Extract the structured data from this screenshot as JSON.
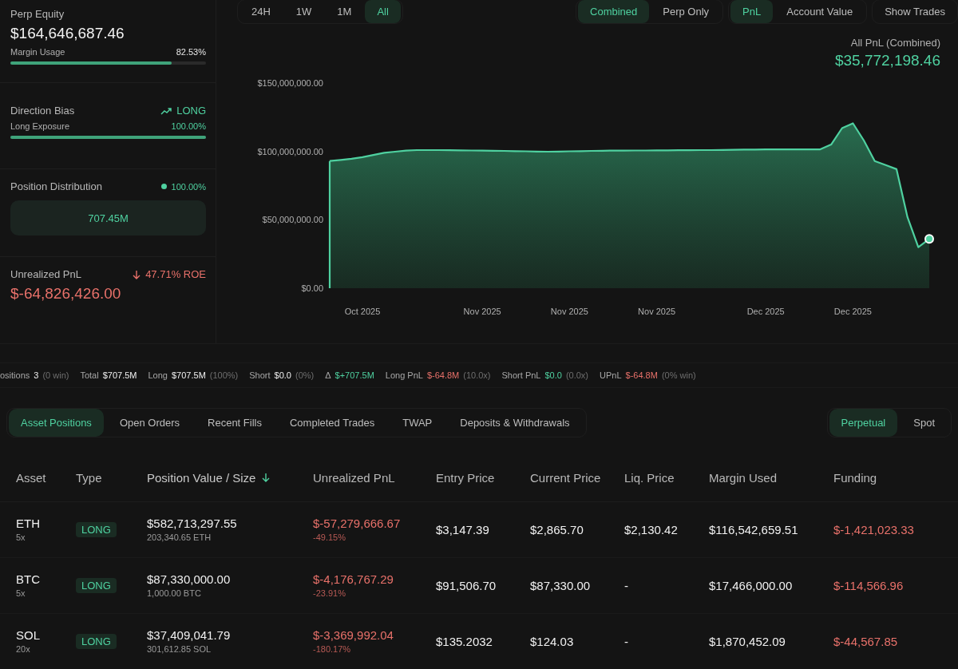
{
  "summary": {
    "perp_equity": {
      "label": "Perp Equity",
      "value": "$164,646,687.46"
    },
    "margin_usage": {
      "label": "Margin Usage",
      "reading": "82.53%",
      "level": 0.8253
    },
    "direction_bias": {
      "label": "Direction Bias",
      "value": "LONG",
      "exposure_label": "Long Exposure",
      "reading": "100.00%",
      "level": 1.0
    },
    "position_distribution": {
      "label": "Position Distribution",
      "reading": "100.00%",
      "color": "#4fd1a0",
      "segment": "707.45M"
    },
    "unrealized_pnl": {
      "label": "Unrealized PnL",
      "roe": "47.71% ROE",
      "value": "$-64,826,426.00"
    }
  },
  "chart_toolbar": {
    "ranges": [
      {
        "label": "24H",
        "selected": false
      },
      {
        "label": "1W",
        "selected": false
      },
      {
        "label": "1M",
        "selected": false
      },
      {
        "label": "All",
        "selected": true
      }
    ],
    "modes": [
      {
        "label": "Combined",
        "selected": true
      },
      {
        "label": "Perp Only",
        "selected": false
      }
    ],
    "metrics": [
      {
        "label": "PnL",
        "selected": true
      },
      {
        "label": "Account Value",
        "selected": false
      }
    ],
    "show_trades": "Show Trades"
  },
  "pnl_header": {
    "label": "All PnL (Combined)",
    "value": "$35,772,198.46"
  },
  "chart": {
    "chart_data": {
      "type": "area",
      "categories": [
        null,
        null,
        null,
        "Oct 2025",
        null,
        null,
        null,
        null,
        null,
        null,
        null,
        null,
        null,
        null,
        "Nov 2025",
        null,
        null,
        null,
        null,
        null,
        null,
        null,
        "Nov 2025",
        null,
        null,
        null,
        null,
        null,
        null,
        null,
        "Nov 2025",
        null,
        null,
        null,
        null,
        null,
        null,
        null,
        null,
        null,
        "Dec 2025",
        null,
        null,
        null,
        null,
        null,
        null,
        null,
        "Dec 2025",
        null,
        null,
        null,
        null,
        null,
        null,
        null
      ],
      "series": [
        {
          "color": "#4fd1a0",
          "values": [
            93000000,
            93800000,
            94600000,
            95800000,
            97400000,
            99000000,
            99800000,
            100600000,
            101000000,
            101000000,
            101000000,
            100900000,
            100800000,
            100700000,
            100600000,
            100500000,
            100400000,
            100200000,
            100100000,
            99900000,
            99800000,
            99900000,
            100100000,
            100200000,
            100400000,
            100500000,
            100600000,
            100600000,
            100700000,
            100700000,
            100800000,
            100800000,
            100900000,
            100900000,
            101000000,
            101000000,
            101100000,
            101200000,
            101300000,
            101400000,
            101500000,
            101500000,
            101500000,
            101500000,
            101500000,
            101500000,
            105000000,
            117000000,
            120500000,
            108000000,
            93000000,
            90000000,
            87000000,
            52000000,
            30000000,
            36000000
          ]
        }
      ],
      "ylim": [
        0,
        150000000
      ],
      "yticks": [
        {
          "value": 0,
          "label": "$0.00"
        },
        {
          "value": 50000000,
          "label": "$50,000,000.00"
        },
        {
          "value": 100000000,
          "label": "$100,000,000.00"
        },
        {
          "value": 150000000,
          "label": "$150,000,000.00"
        }
      ]
    }
  },
  "stats_strip": [
    {
      "label": "ositions",
      "value": "3",
      "note": "(0 win)",
      "color": "#f0f0f0"
    },
    {
      "label": "Total",
      "value": "$707.5M",
      "color": "#f0f0f0"
    },
    {
      "label": "Long",
      "value": "$707.5M",
      "note": "(100%)",
      "color": "#f0f0f0"
    },
    {
      "label": "Short",
      "value": "$0.0",
      "note": "(0%)",
      "color": "#f0f0f0"
    },
    {
      "label": "Δ",
      "value": "$+707.5M",
      "color": "#4fd1a0"
    },
    {
      "label": "Long PnL",
      "value": "$-64.8M",
      "note": "(10.0x)",
      "color": "#e8716a"
    },
    {
      "label": "Short PnL",
      "value": "$0.0",
      "note": "(0.0x)",
      "color": "#4fd1a0"
    },
    {
      "label": "UPnL",
      "value": "$-64.8M",
      "note": "(0% win)",
      "color": "#e8716a"
    }
  ],
  "tabs": [
    {
      "label": "Asset Positions",
      "selected": true
    },
    {
      "label": "Open Orders",
      "selected": false
    },
    {
      "label": "Recent Fills",
      "selected": false
    },
    {
      "label": "Completed Trades",
      "selected": false
    },
    {
      "label": "TWAP",
      "selected": false
    },
    {
      "label": "Deposits & Withdrawals",
      "selected": false
    }
  ],
  "market_tabs": [
    {
      "label": "Perpetual",
      "selected": true
    },
    {
      "label": "Spot",
      "selected": false
    }
  ],
  "table": {
    "columns": [
      {
        "label": "Asset",
        "sorted": false
      },
      {
        "label": "Type",
        "sorted": false
      },
      {
        "label": "Position Value / Size",
        "sorted": true
      },
      {
        "label": "Unrealized PnL",
        "sorted": false
      },
      {
        "label": "Entry Price",
        "sorted": false
      },
      {
        "label": "Current Price",
        "sorted": false
      },
      {
        "label": "Liq. Price",
        "sorted": false
      },
      {
        "label": "Margin Used",
        "sorted": false
      },
      {
        "label": "Funding",
        "sorted": false
      }
    ],
    "rows": [
      {
        "asset": "ETH",
        "leverage": "5x",
        "type": "LONG",
        "position_value": "$582,713,297.55",
        "size": "203,340.65 ETH",
        "unrealized_pnl": "$-57,279,666.67",
        "pnl_percent": "-49.15%",
        "entry_price": "$3,147.39",
        "current_price": "$2,865.70",
        "liq_price": "$2,130.42",
        "margin_used": "$116,542,659.51",
        "funding": "$-1,421,023.33"
      },
      {
        "asset": "BTC",
        "leverage": "5x",
        "type": "LONG",
        "position_value": "$87,330,000.00",
        "size": "1,000.00 BTC",
        "unrealized_pnl": "$-4,176,767.29",
        "pnl_percent": "-23.91%",
        "entry_price": "$91,506.70",
        "current_price": "$87,330.00",
        "liq_price": "-",
        "margin_used": "$17,466,000.00",
        "funding": "$-114,566.96"
      },
      {
        "asset": "SOL",
        "leverage": "20x",
        "type": "LONG",
        "position_value": "$37,409,041.79",
        "size": "301,612.85 SOL",
        "unrealized_pnl": "$-3,369,992.04",
        "pnl_percent": "-180.17%",
        "entry_price": "$135.2032",
        "current_price": "$124.03",
        "liq_price": "-",
        "margin_used": "$1,870,452.09",
        "funding": "$-44,567.85"
      }
    ]
  }
}
